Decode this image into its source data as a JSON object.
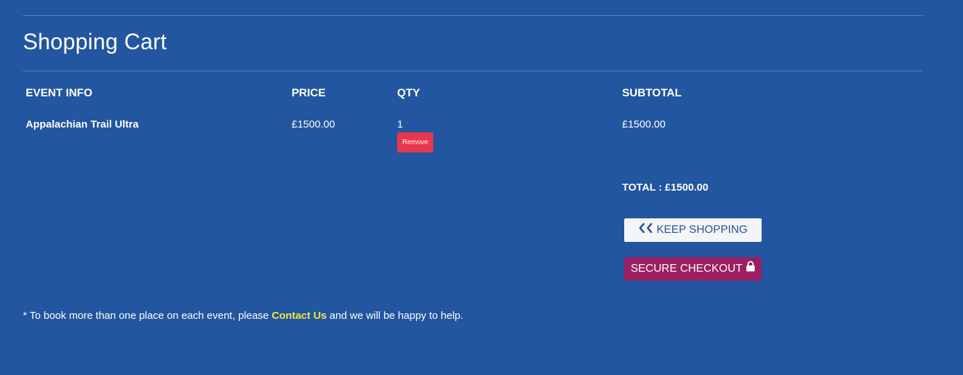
{
  "header": {
    "title": "Shopping Cart"
  },
  "table": {
    "columns": [
      "EVENT INFO",
      "PRICE",
      "QTY",
      "SUBTOTAL"
    ],
    "rows": [
      {
        "event": "Appalachian Trail Ultra",
        "price": "£1500.00",
        "qty": "1",
        "remove_label": "Remove",
        "subtotal": "£1500.00"
      }
    ]
  },
  "summary": {
    "total": "TOTAL : £1500.00"
  },
  "actions": {
    "keep_shopping_label": "KEEP SHOPPING",
    "secure_checkout_label": "SECURE CHECKOUT"
  },
  "footer_note": {
    "before": "* To book more than one place on each event, please ",
    "link": "Contact Us",
    "after": " and we will be happy to help."
  },
  "colors": {
    "background": "#2256a0",
    "remove": "#e8364e",
    "checkout": "#9b1f62",
    "link": "#f5e342"
  },
  "icons": {
    "keep_shopping": "double-chevron-left-icon",
    "secure_checkout": "lock-icon"
  }
}
